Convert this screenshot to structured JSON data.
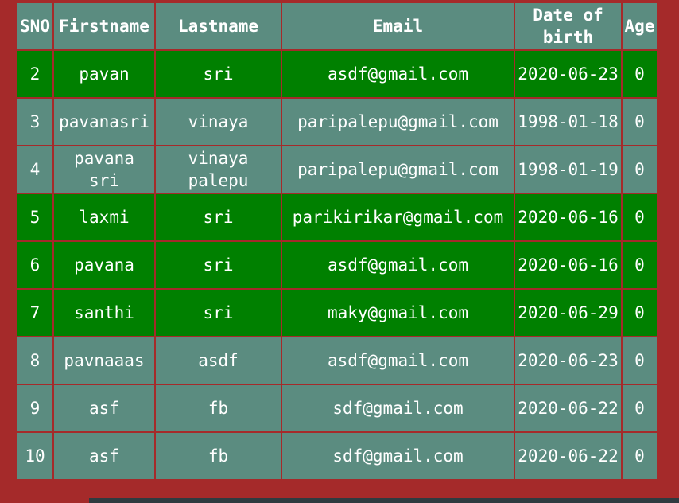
{
  "table": {
    "headers": [
      "SNO",
      "Firstname",
      "Lastname",
      "Email",
      "Date of birth",
      "Age"
    ],
    "rows": [
      {
        "sno": "2",
        "firstname": "pavan",
        "lastname": "sri",
        "email": "asdf@gmail.com",
        "dob": "2020-06-23",
        "age": "0",
        "color": "#008000"
      },
      {
        "sno": "3",
        "firstname": "pavanasri",
        "lastname": "vinaya",
        "email": "paripalepu@gmail.com",
        "dob": "1998-01-18",
        "age": "0",
        "color": "#5b8c80"
      },
      {
        "sno": "4",
        "firstname": "pavana sri",
        "lastname": "vinaya palepu",
        "email": "paripalepu@gmail.com",
        "dob": "1998-01-19",
        "age": "0",
        "color": "#5b8c80"
      },
      {
        "sno": "5",
        "firstname": "laxmi",
        "lastname": "sri",
        "email": "parikirikar@gmail.com",
        "dob": "2020-06-16",
        "age": "0",
        "color": "#008000"
      },
      {
        "sno": "6",
        "firstname": "pavana",
        "lastname": "sri",
        "email": "asdf@gmail.com",
        "dob": "2020-06-16",
        "age": "0",
        "color": "#008000"
      },
      {
        "sno": "7",
        "firstname": "santhi",
        "lastname": "sri",
        "email": "maky@gmail.com",
        "dob": "2020-06-29",
        "age": "0",
        "color": "#008000"
      },
      {
        "sno": "8",
        "firstname": "pavnaaas",
        "lastname": "asdf",
        "email": "asdf@gmail.com",
        "dob": "2020-06-23",
        "age": "0",
        "color": "#5b8c80"
      },
      {
        "sno": "9",
        "firstname": "asf",
        "lastname": "fb",
        "email": "sdf@gmail.com",
        "dob": "2020-06-22",
        "age": "0",
        "color": "#5b8c80"
      },
      {
        "sno": "10",
        "firstname": "asf",
        "lastname": "fb",
        "email": "sdf@gmail.com",
        "dob": "2020-06-22",
        "age": "0",
        "color": "#5b8c80"
      }
    ]
  },
  "colors": {
    "frame": "#a52a2a",
    "green_row": "#008000",
    "teal_row": "#5b8c80",
    "text": "#ffffff"
  }
}
